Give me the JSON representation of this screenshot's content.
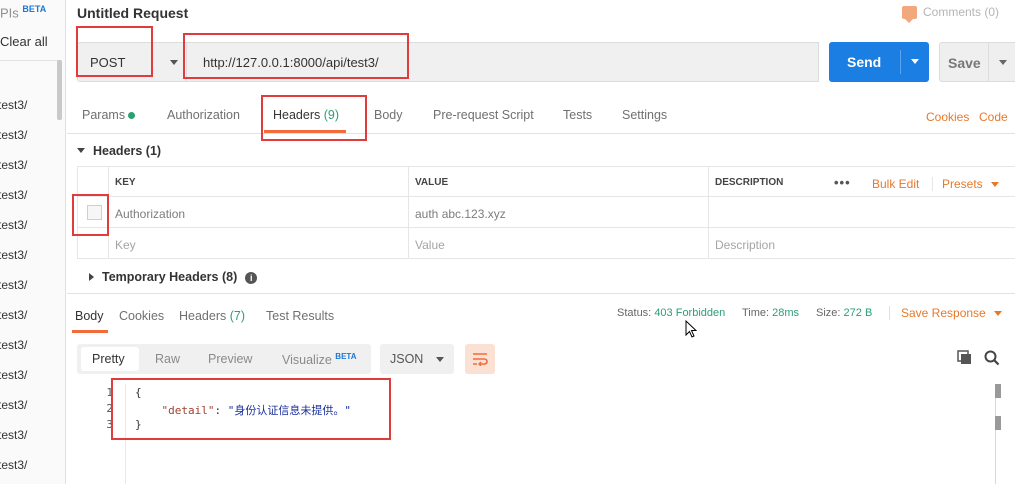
{
  "sidebar": {
    "apis_label": "PIs",
    "beta": "BETA",
    "clear_all": "Clear all",
    "items": [
      "test3/",
      "test3/",
      "test3/",
      "test3/",
      "test3/",
      "test3/",
      "test3/",
      "test3/",
      "test3/",
      "test3/",
      "test3/",
      "test3/",
      "test3/"
    ]
  },
  "request": {
    "title": "Untitled Request",
    "comments": "Comments (0)",
    "method": "POST",
    "url": "http://127.0.0.1:8000/api/test3/",
    "send": "Send",
    "save": "Save"
  },
  "req_tabs": {
    "params": "Params",
    "authorization": "Authorization",
    "headers": "Headers",
    "headers_count": "(9)",
    "body": "Body",
    "prerequest": "Pre-request Script",
    "tests": "Tests",
    "settings": "Settings",
    "cookies": "Cookies",
    "code": "Code"
  },
  "headers_section": {
    "title": "Headers (1)",
    "columns": {
      "key": "KEY",
      "value": "VALUE",
      "description": "DESCRIPTION"
    },
    "bulk_edit": "Bulk Edit",
    "presets": "Presets",
    "rows": [
      {
        "key": "Authorization",
        "value": "auth abc.123.xyz",
        "description": ""
      }
    ],
    "placeholder": {
      "key": "Key",
      "value": "Value",
      "description": "Description"
    },
    "temporary": "Temporary Headers (8)"
  },
  "response": {
    "tabs": {
      "body": "Body",
      "cookies": "Cookies",
      "headers": "Headers",
      "headers_count": "(7)",
      "test_results": "Test Results"
    },
    "status_label": "Status:",
    "status_value": "403 Forbidden",
    "time_label": "Time:",
    "time_value": "28ms",
    "size_label": "Size:",
    "size_value": "272 B",
    "save_response": "Save Response",
    "formats": {
      "pretty": "Pretty",
      "raw": "Raw",
      "preview": "Preview",
      "visualize": "Visualize",
      "beta": "BETA"
    },
    "language": "JSON",
    "code": {
      "line_numbers": [
        "1",
        "2",
        "3"
      ],
      "open_brace": "{",
      "key": "\"detail\"",
      "colon": ": ",
      "value": "\"身份认证信息未提供。\"",
      "close_brace": "}"
    }
  },
  "colors": {
    "accent": "#f26b3a",
    "link": "#e8782a",
    "primary": "#1a7ee3",
    "success": "#2aa073",
    "annotation": "#e23b3b"
  }
}
